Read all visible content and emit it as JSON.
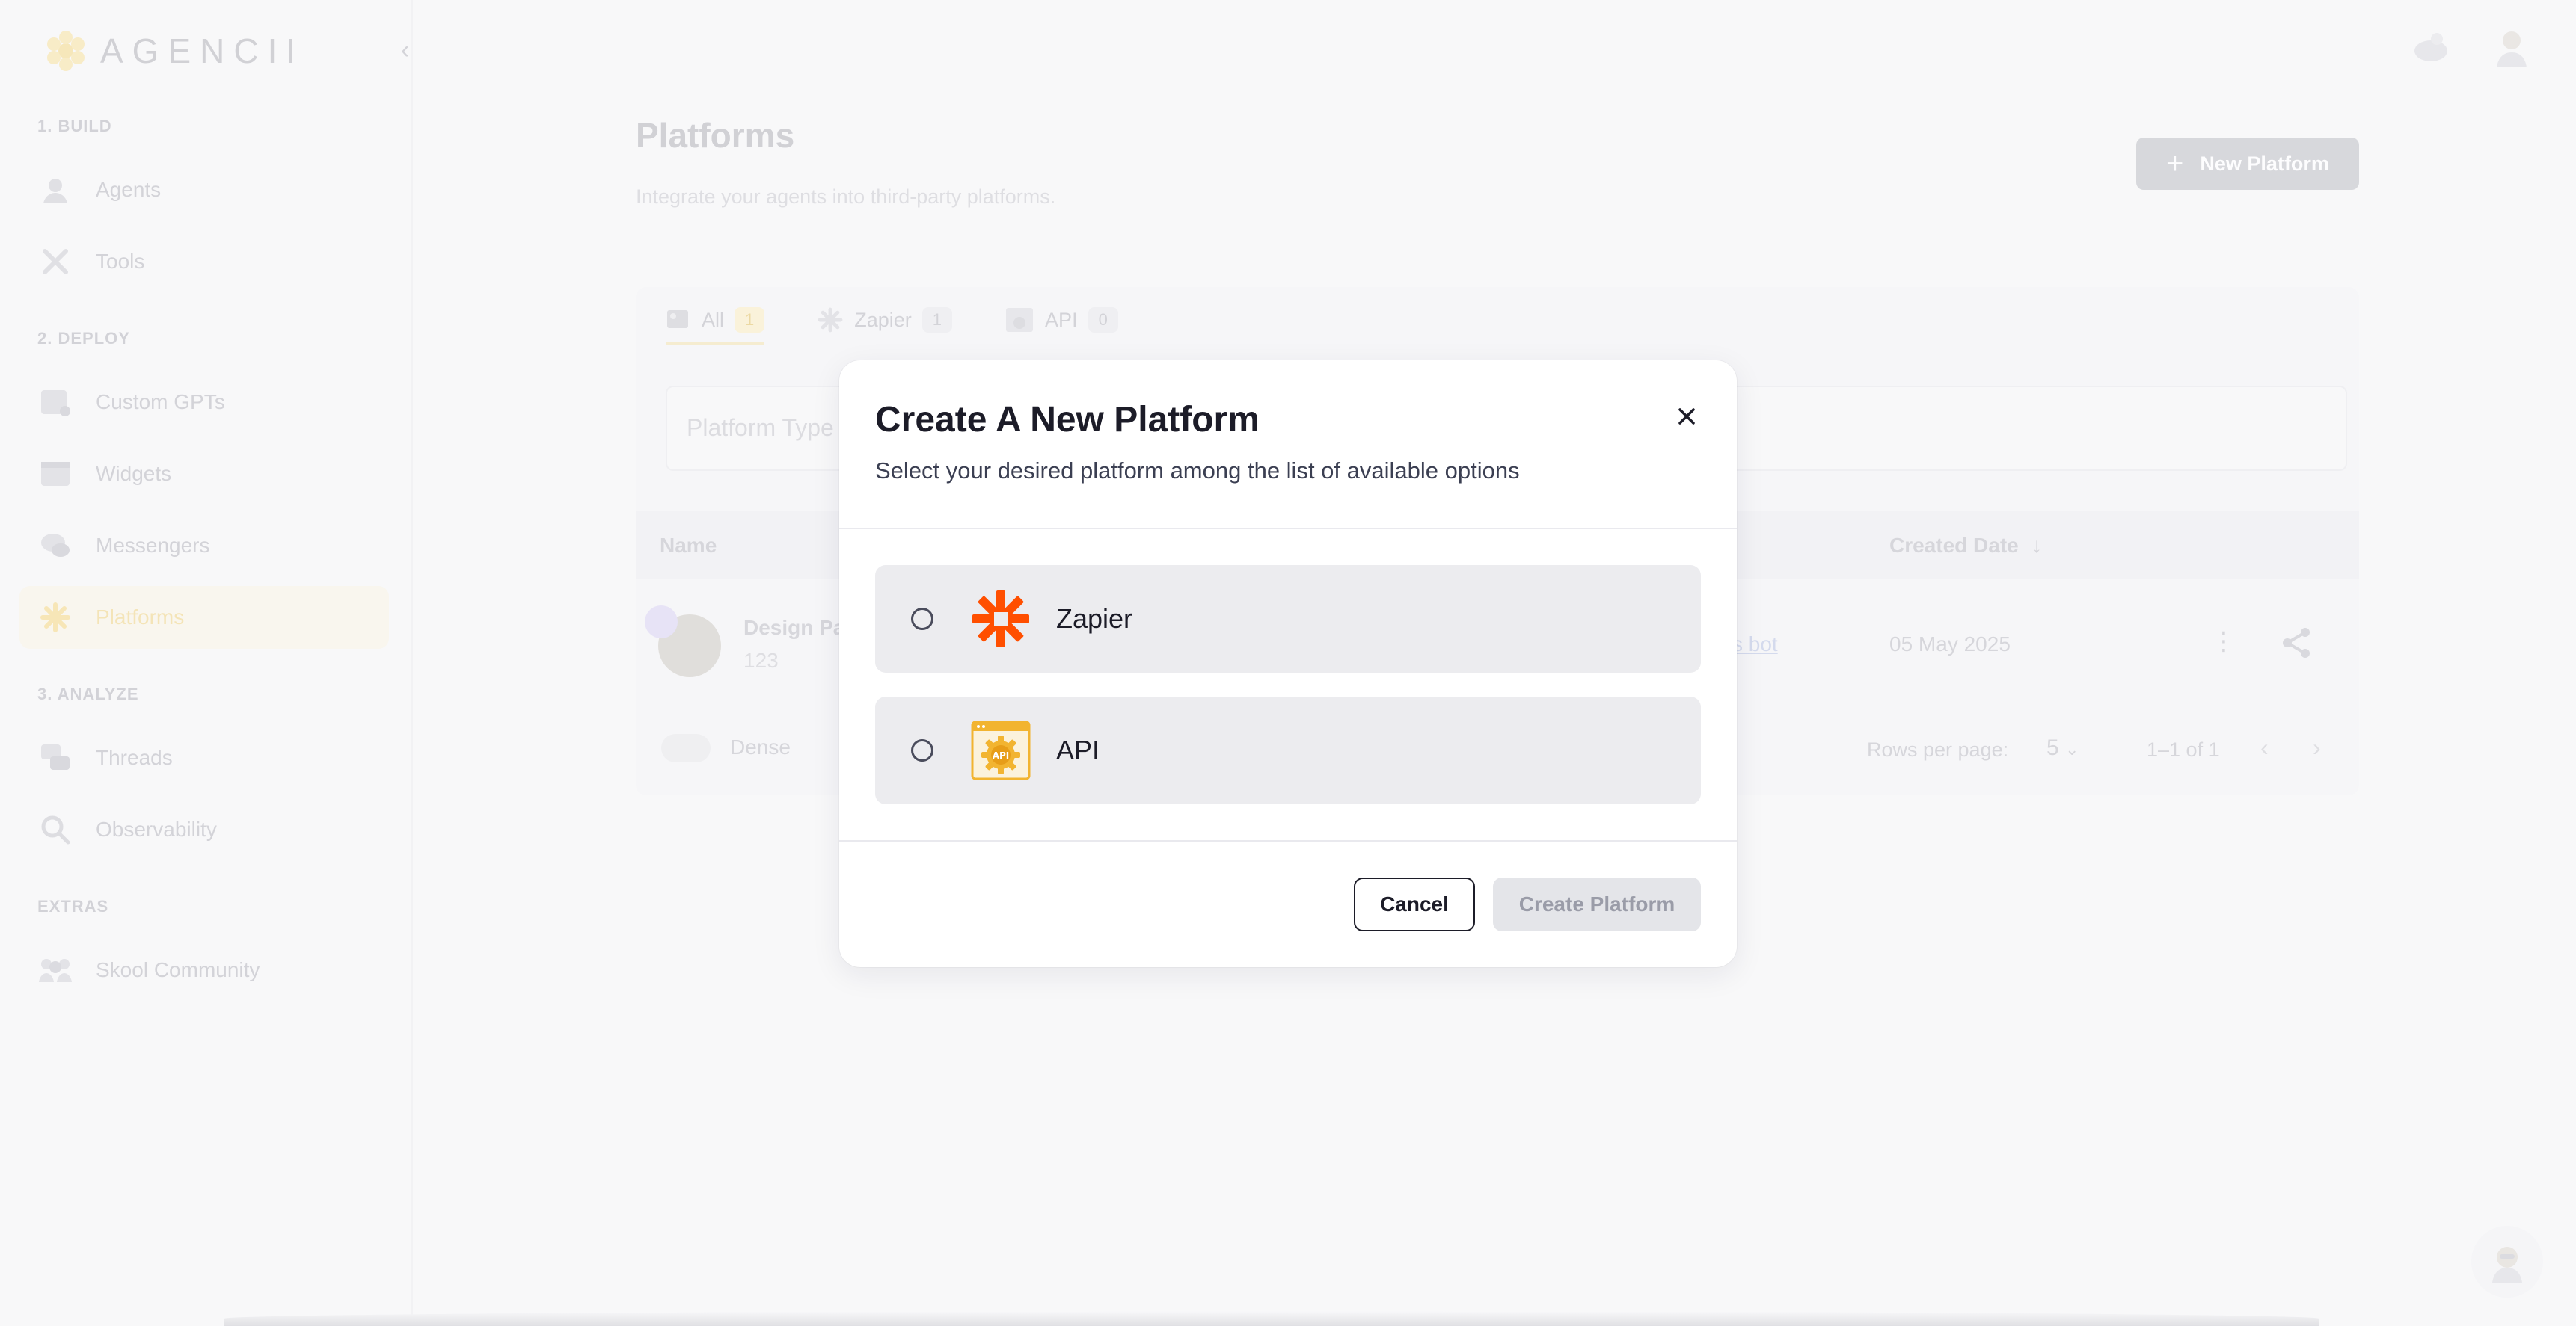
{
  "sidebar": {
    "logo_text": "AGENCII",
    "sections": [
      {
        "label": "1. BUILD",
        "items": [
          {
            "label": "Agents",
            "icon": "agent-icon"
          },
          {
            "label": "Tools",
            "icon": "tools-icon"
          }
        ]
      },
      {
        "label": "2. DEPLOY",
        "items": [
          {
            "label": "Custom GPTs",
            "icon": "custom-gpt-icon"
          },
          {
            "label": "Widgets",
            "icon": "widget-icon"
          },
          {
            "label": "Messengers",
            "icon": "messenger-icon"
          },
          {
            "label": "Platforms",
            "icon": "platform-icon",
            "active": true
          }
        ]
      },
      {
        "label": "3. ANALYZE",
        "items": [
          {
            "label": "Threads",
            "icon": "threads-icon"
          },
          {
            "label": "Observability",
            "icon": "observability-icon"
          }
        ]
      },
      {
        "label": "EXTRAS",
        "items": [
          {
            "label": "Skool Community",
            "icon": "community-icon"
          }
        ]
      }
    ]
  },
  "header": {
    "title": "Platforms",
    "subtitle": "Integrate your agents into third-party platforms.",
    "new_button": "New Platform"
  },
  "tabs": [
    {
      "label": "All",
      "count": "1"
    },
    {
      "label": "Zapier",
      "count": "1"
    },
    {
      "label": "API",
      "count": "0"
    }
  ],
  "filter": {
    "placeholder": "Platform Type"
  },
  "table": {
    "col_name": "Name",
    "col_date": "Created Date",
    "row": {
      "name": "Design Pa",
      "sub": "123",
      "link": "s bot",
      "date": "05 May 2025"
    },
    "dense_label": "Dense",
    "rows_per_page_label": "Rows per page:",
    "rows_per_page_value": "5",
    "range": "1–1 of 1"
  },
  "modal": {
    "title": "Create A New Platform",
    "subtitle": "Select your desired platform among the list of available options",
    "options": [
      {
        "label": "Zapier",
        "icon": "zapier-logo-icon"
      },
      {
        "label": "API",
        "icon": "api-logo-icon"
      }
    ],
    "cancel_label": "Cancel",
    "create_label": "Create Platform"
  },
  "colors": {
    "accent_yellow": "#f5c842",
    "zapier_orange": "#ff4f00",
    "api_gold": "#f2b430",
    "text_dark": "#1c1c28"
  }
}
